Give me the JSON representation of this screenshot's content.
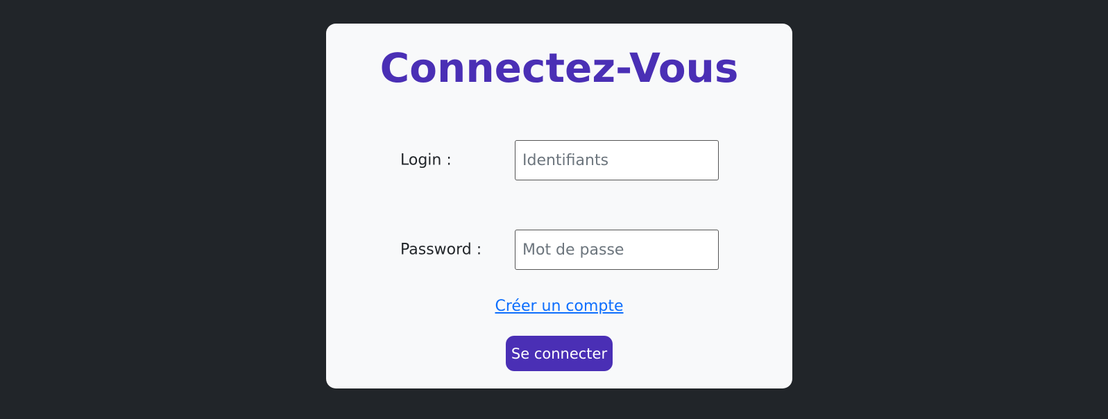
{
  "page": {
    "background_color": "#212529",
    "card_color": "#f8f9fa",
    "accent_color": "#4a2fb5",
    "link_color": "#0d6efd"
  },
  "login_form": {
    "title": "Connectez-Vous",
    "login": {
      "label": "Login :",
      "value": "",
      "placeholder": "Identifiants"
    },
    "password": {
      "label": "Password :",
      "value": "",
      "placeholder": "Mot de passe"
    },
    "create_account_link": "Créer un compte",
    "submit_label": "Se connecter"
  }
}
